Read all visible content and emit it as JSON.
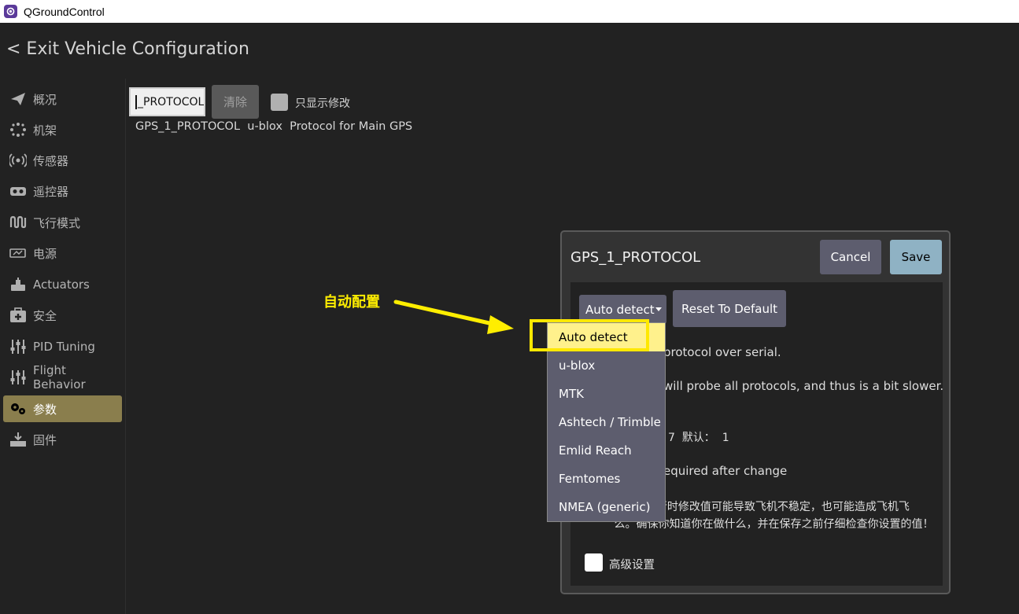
{
  "app": {
    "title": "QGroundControl"
  },
  "nav": {
    "exit_label": "< Exit Vehicle Configuration"
  },
  "sidebar": {
    "items": [
      {
        "label": "概况",
        "icon": "paper-plane-icon"
      },
      {
        "label": "机架",
        "icon": "airframe-icon"
      },
      {
        "label": "传感器",
        "icon": "sensors-icon"
      },
      {
        "label": "遥控器",
        "icon": "radio-icon"
      },
      {
        "label": "飞行模式",
        "icon": "flight-modes-icon"
      },
      {
        "label": "电源",
        "icon": "battery-icon"
      },
      {
        "label": "Actuators",
        "icon": "actuators-icon"
      },
      {
        "label": "安全",
        "icon": "safety-icon"
      },
      {
        "label": "PID Tuning",
        "icon": "sliders-icon"
      },
      {
        "label": "Flight Behavior",
        "icon": "sliders-icon"
      },
      {
        "label": "参数",
        "icon": "gears-icon",
        "active": true
      },
      {
        "label": "固件",
        "icon": "firmware-icon"
      }
    ]
  },
  "params": {
    "search_value": "_PROTOCOL",
    "clear_label": "清除",
    "only_modified_label": "只显示修改",
    "row": {
      "name": "GPS_1_PROTOCOL",
      "value": "u-blox",
      "description": "Protocol for Main GPS"
    }
  },
  "dialog": {
    "title": "GPS_1_PROTOCOL",
    "cancel_label": "Cancel",
    "save_label": "Save",
    "combo_value": "Auto detect",
    "reset_label": "Reset To Default",
    "text_line1": "protocol over serial.",
    "text_line2": "will probe all protocols, and thus is a bit slower.",
    "text_range": "7  默认：  1",
    "text_reboot": "equired after change",
    "warning_line1": "                      行时修改值可能导致飞机不稳定，也可能造成飞机飞",
    "warning_line2": "          么。确保你知道你在做什么，并在保存之前仔细检查你设置的值！",
    "advanced_label": "高级设置"
  },
  "dropdown": {
    "options": [
      "Auto detect",
      "u-blox",
      "MTK",
      "Ashtech / Trimble",
      "Emlid Reach",
      "Femtomes",
      "NMEA (generic)"
    ],
    "selected_index": 0
  },
  "annotation": {
    "label": "自动配置",
    "color": "#ffee00"
  },
  "colors": {
    "active_nav": "#8a7e4d",
    "button": "#5d5d6e",
    "save": "#8fb2c4",
    "highlight": "#fff18c"
  }
}
